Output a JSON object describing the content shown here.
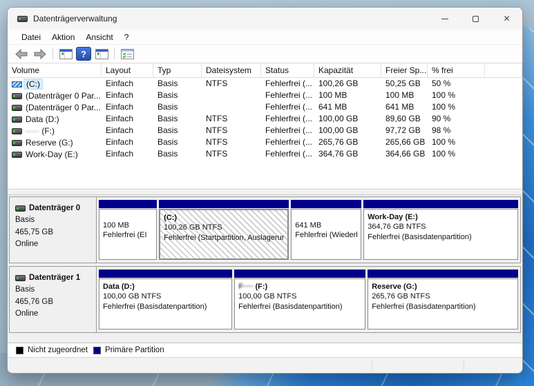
{
  "window": {
    "title": "Datenträgerverwaltung",
    "controls": {
      "close_glyph": "✕"
    }
  },
  "menu": {
    "items": [
      "Datei",
      "Aktion",
      "Ansicht",
      "?"
    ]
  },
  "toolbar": {
    "icons": [
      "back-arrow",
      "forward-arrow",
      "show-console-tree",
      "help",
      "show-action-pane",
      "customize-view"
    ],
    "help_glyph": "?"
  },
  "volume_table": {
    "columns": [
      "Volume",
      "Layout",
      "Typ",
      "Dateisystem",
      "Status",
      "Kapazität",
      "Freier Sp...",
      "% frei"
    ],
    "rows": [
      {
        "name": "(C:)",
        "layout": "Einfach",
        "type": "Basis",
        "fs": "NTFS",
        "status": "Fehlerfrei (...",
        "capacity": "100,26 GB",
        "free": "50,25 GB",
        "pct_free": "50 %"
      },
      {
        "name": "(Datenträger 0 Par...",
        "layout": "Einfach",
        "type": "Basis",
        "fs": "",
        "status": "Fehlerfrei (...",
        "capacity": "100 MB",
        "free": "100 MB",
        "pct_free": "100 %"
      },
      {
        "name": "(Datenträger 0 Par...",
        "layout": "Einfach",
        "type": "Basis",
        "fs": "",
        "status": "Fehlerfrei (...",
        "capacity": "641 MB",
        "free": "641 MB",
        "pct_free": "100 %"
      },
      {
        "name": "Data (D:)",
        "layout": "Einfach",
        "type": "Basis",
        "fs": "NTFS",
        "status": "Fehlerfrei (...",
        "capacity": "100,00 GB",
        "free": "89,60 GB",
        "pct_free": "90 %"
      },
      {
        "name_blur": "·····",
        "name_rest": " (F:)",
        "layout": "Einfach",
        "type": "Basis",
        "fs": "NTFS",
        "status": "Fehlerfrei (...",
        "capacity": "100,00 GB",
        "free": "97,72 GB",
        "pct_free": "98 %"
      },
      {
        "name": "Reserve (G:)",
        "layout": "Einfach",
        "type": "Basis",
        "fs": "NTFS",
        "status": "Fehlerfrei (...",
        "capacity": "265,76 GB",
        "free": "265,66 GB",
        "pct_free": "100 %"
      },
      {
        "name": "Work-Day (E:)",
        "layout": "Einfach",
        "type": "Basis",
        "fs": "NTFS",
        "status": "Fehlerfrei (...",
        "capacity": "364,76 GB",
        "free": "364,66 GB",
        "pct_free": "100 %"
      }
    ]
  },
  "disks": [
    {
      "name": "Datenträger 0",
      "type": "Basis",
      "size": "465,75 GB",
      "status": "Online",
      "partitions": [
        {
          "line1": "100 MB",
          "line2": "Fehlerfrei (EI"
        },
        {
          "title": "(C:)",
          "line1": "100,26 GB NTFS",
          "line2": "Fehlerfrei (Startpartition, Auslagerur"
        },
        {
          "line1": "641 MB",
          "line2": "Fehlerfrei (Wiederh"
        },
        {
          "title": "Work-Day  (E:)",
          "line1": "364,76 GB NTFS",
          "line2": "Fehlerfrei (Basisdatenpartition)"
        }
      ]
    },
    {
      "name": "Datenträger 1",
      "type": "Basis",
      "size": "465,76 GB",
      "status": "Online",
      "partitions": [
        {
          "title": "Data  (D:)",
          "line1": "100,00 GB NTFS",
          "line2": "Fehlerfrei (Basisdatenpartition)"
        },
        {
          "title_blur": "F····",
          "title_rest": "  (F:)",
          "line1": "100,00 GB NTFS",
          "line2": "Fehlerfrei (Basisdatenpartition)"
        },
        {
          "title": "Reserve  (G:)",
          "line1": "265,76 GB NTFS",
          "line2": "Fehlerfrei (Basisdatenpartition)"
        }
      ]
    }
  ],
  "legend": {
    "unallocated": "Nicht zugeordnet",
    "primary": "Primäre Partition"
  },
  "colors": {
    "primary_partition": "#00008b",
    "unallocated": "#000000",
    "selection_hatch": "#d2d2d2"
  }
}
